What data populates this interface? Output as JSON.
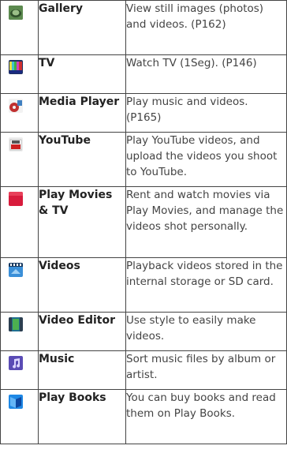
{
  "rows": [
    {
      "name": "Gallery",
      "description": "View still images (photos) and videos. (P162)",
      "icon": "gallery-icon"
    },
    {
      "name": "TV",
      "description": "Watch TV (1Seg). (P146)",
      "icon": "tv-icon"
    },
    {
      "name": "Media Player",
      "description": "Play music and videos. (P165)",
      "icon": "media-player-icon"
    },
    {
      "name": "YouTube",
      "description": "Play YouTube videos, and upload the videos you shoot to YouTube.",
      "icon": "youtube-icon"
    },
    {
      "name": "Play Movies & TV",
      "description": "Rent and watch movies via Play Movies, and manage the videos shot personally.",
      "icon": "play-movies-icon"
    },
    {
      "name": "Videos",
      "description": "Playback videos stored in the internal storage or SD card.",
      "icon": "videos-icon"
    },
    {
      "name": "Video Editor",
      "description": "Use style to easily make videos.",
      "icon": "video-editor-icon"
    },
    {
      "name": "Music",
      "description": "Sort music files by album or artist.",
      "icon": "music-icon"
    },
    {
      "name": "Play Books",
      "description": "You can buy books and read them on Play Books.",
      "icon": "play-books-icon"
    }
  ]
}
